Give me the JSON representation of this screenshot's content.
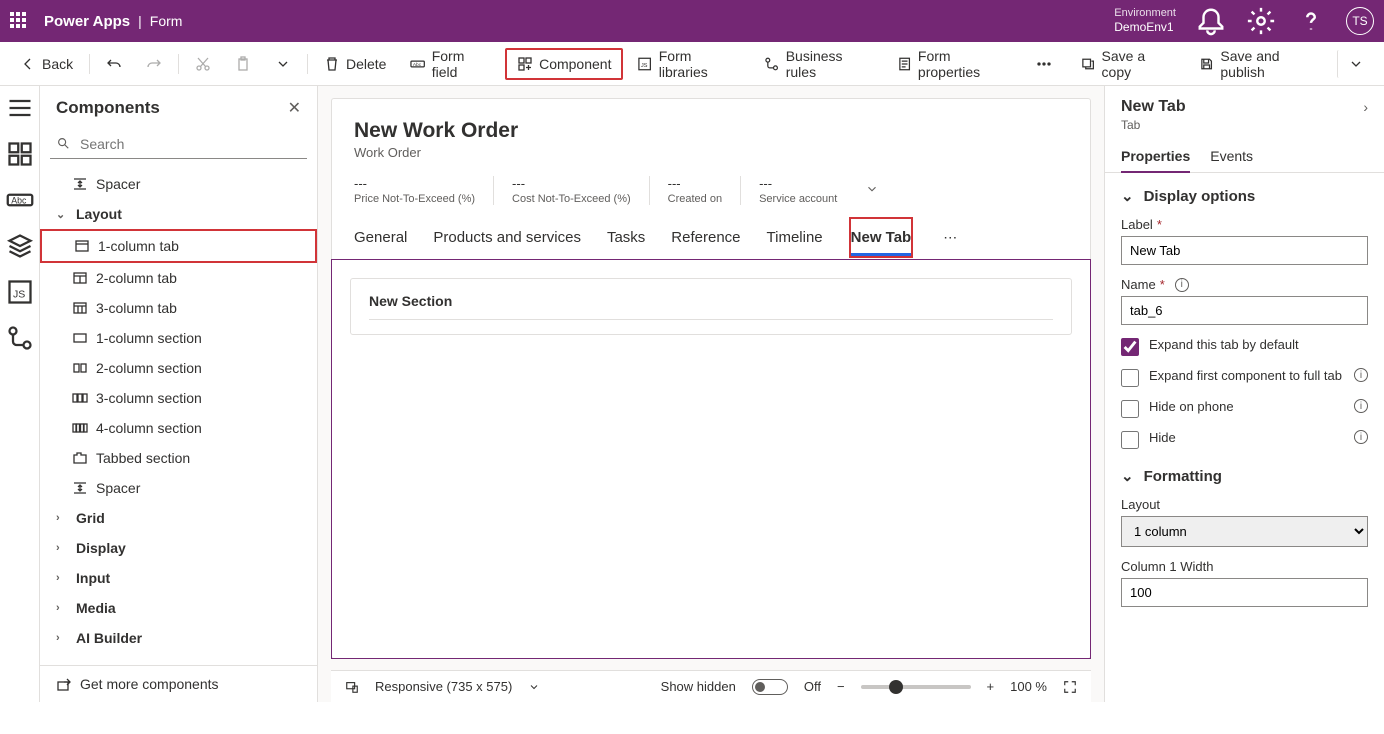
{
  "appbar": {
    "brand": "Power Apps",
    "page": "Form",
    "env_label": "Environment",
    "env_name": "DemoEnv1",
    "avatar": "TS"
  },
  "toolbar": {
    "back": "Back",
    "delete": "Delete",
    "form_field": "Form field",
    "component": "Component",
    "form_libraries": "Form libraries",
    "business_rules": "Business rules",
    "form_properties": "Form properties",
    "save_copy": "Save a copy",
    "save_publish": "Save and publish"
  },
  "components": {
    "title": "Components",
    "search_placeholder": "Search",
    "get_more": "Get more components",
    "items": {
      "spacer1": "Spacer",
      "layout": "Layout",
      "col1tab": "1-column tab",
      "col2tab": "2-column tab",
      "col3tab": "3-column tab",
      "col1sec": "1-column section",
      "col2sec": "2-column section",
      "col3sec": "3-column section",
      "col4sec": "4-column section",
      "tabbed": "Tabbed section",
      "spacer2": "Spacer",
      "grid": "Grid",
      "display": "Display",
      "input": "Input",
      "media": "Media",
      "aibuilder": "AI Builder"
    }
  },
  "form": {
    "title": "New Work Order",
    "entity": "Work Order",
    "header_fields": [
      {
        "value": "---",
        "label": "Price Not-To-Exceed (%)"
      },
      {
        "value": "---",
        "label": "Cost Not-To-Exceed (%)"
      },
      {
        "value": "---",
        "label": "Created on"
      },
      {
        "value": "---",
        "label": "Service account"
      }
    ],
    "tabs": [
      "General",
      "Products and services",
      "Tasks",
      "Reference",
      "Timeline",
      "New Tab"
    ],
    "active_tab": "New Tab",
    "section_title": "New Section"
  },
  "statusbar": {
    "responsive": "Responsive (735 x 575)",
    "show_hidden": "Show hidden",
    "off": "Off",
    "zoom": "100 %"
  },
  "props": {
    "title": "New Tab",
    "subtitle": "Tab",
    "tabs": {
      "properties": "Properties",
      "events": "Events"
    },
    "display_options": "Display options",
    "label_lbl": "Label",
    "label_val": "New Tab",
    "name_lbl": "Name",
    "name_val": "tab_6",
    "expand_default": "Expand this tab by default",
    "expand_first": "Expand first component to full tab",
    "hide_phone": "Hide on phone",
    "hide": "Hide",
    "formatting": "Formatting",
    "layout_lbl": "Layout",
    "layout_val": "1 column",
    "col_width_lbl": "Column 1 Width",
    "col_width_val": "100"
  }
}
